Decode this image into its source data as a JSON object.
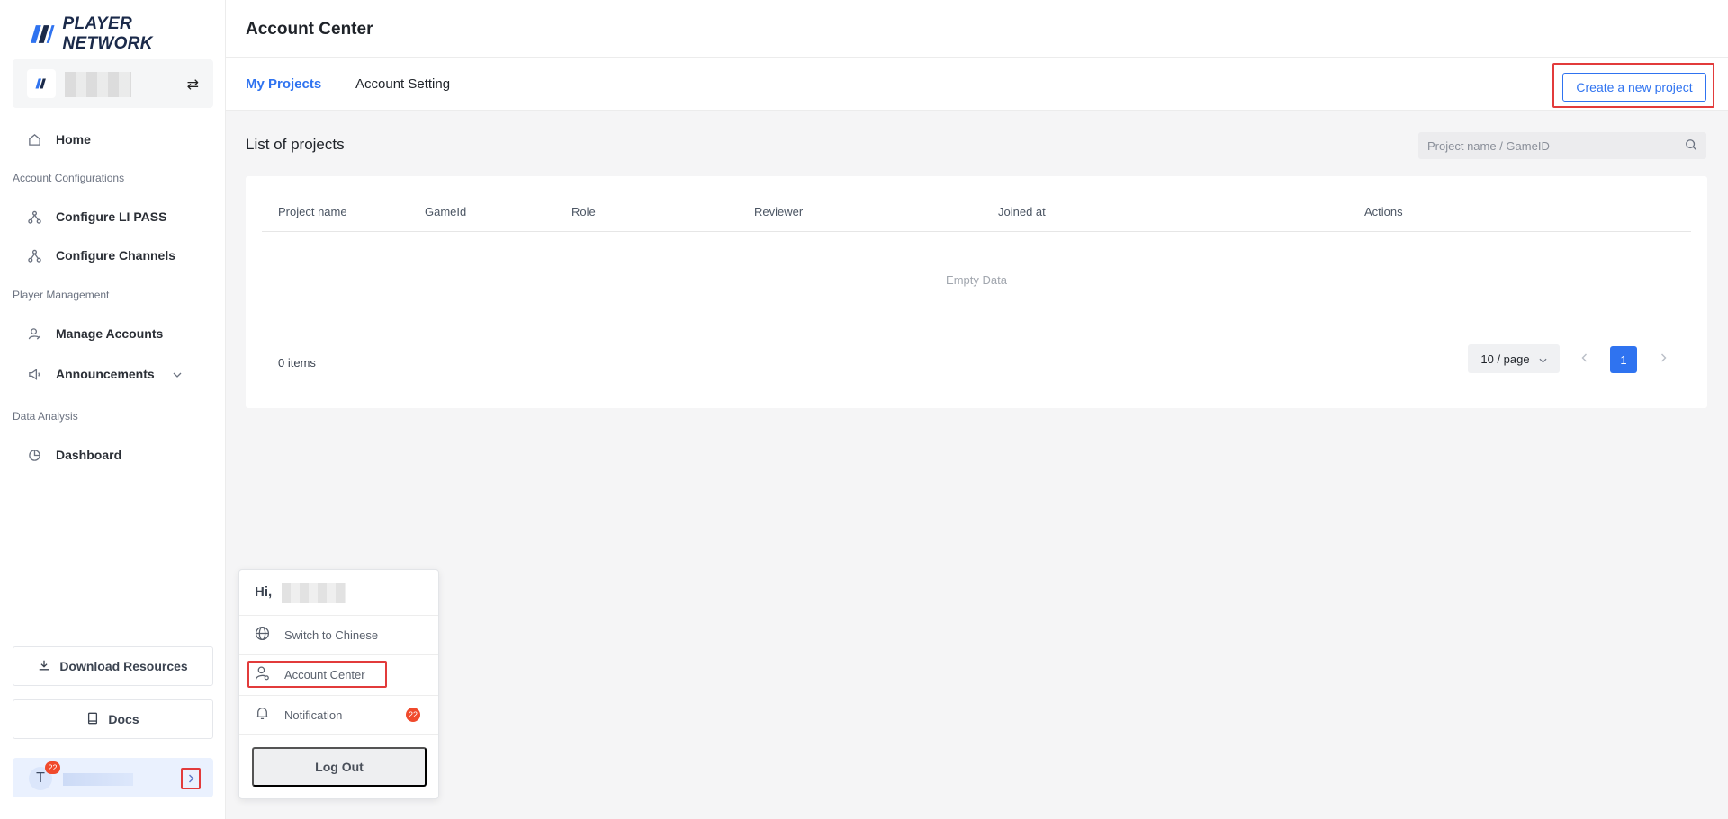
{
  "brand": {
    "name": "PLAYER NETWORK",
    "accent": "#2f73f0",
    "highlight": "#e23b3b"
  },
  "sidebar": {
    "switch_icon": "swap-icon",
    "items": [
      {
        "label": "Home",
        "icon": "home-icon"
      },
      {
        "section": "Account Configurations"
      },
      {
        "label": "Configure LI PASS",
        "icon": "nodes-icon"
      },
      {
        "label": "Configure Channels",
        "icon": "nodes-icon"
      },
      {
        "section": "Player Management"
      },
      {
        "label": "Manage Accounts",
        "icon": "user-edit-icon"
      },
      {
        "label": "Announcements",
        "icon": "speaker-icon"
      },
      {
        "section": "Data Analysis"
      },
      {
        "label": "Dashboard",
        "icon": "pie-chart-icon"
      }
    ],
    "download_label": "Download Resources",
    "docs_label": "Docs",
    "user": {
      "initial": "T",
      "badge": "22"
    }
  },
  "header": {
    "title": "Account Center"
  },
  "tabs": [
    {
      "label": "My Projects",
      "active": true
    },
    {
      "label": "Account Setting",
      "active": false
    }
  ],
  "create_button": "Create a new project",
  "list": {
    "title": "List of projects",
    "search_placeholder": "Project name / GameID",
    "columns": [
      "Project name",
      "GameId",
      "Role",
      "Reviewer",
      "Joined at",
      "Actions"
    ],
    "empty_text": "Empty Data",
    "items_count": "0 items",
    "page_size": "10 / page",
    "current_page": "1"
  },
  "popup": {
    "greeting": "Hi,",
    "switch_language": "Switch to Chinese",
    "account_center": "Account Center",
    "notification": "Notification",
    "notification_badge": "22",
    "logout": "Log Out"
  }
}
